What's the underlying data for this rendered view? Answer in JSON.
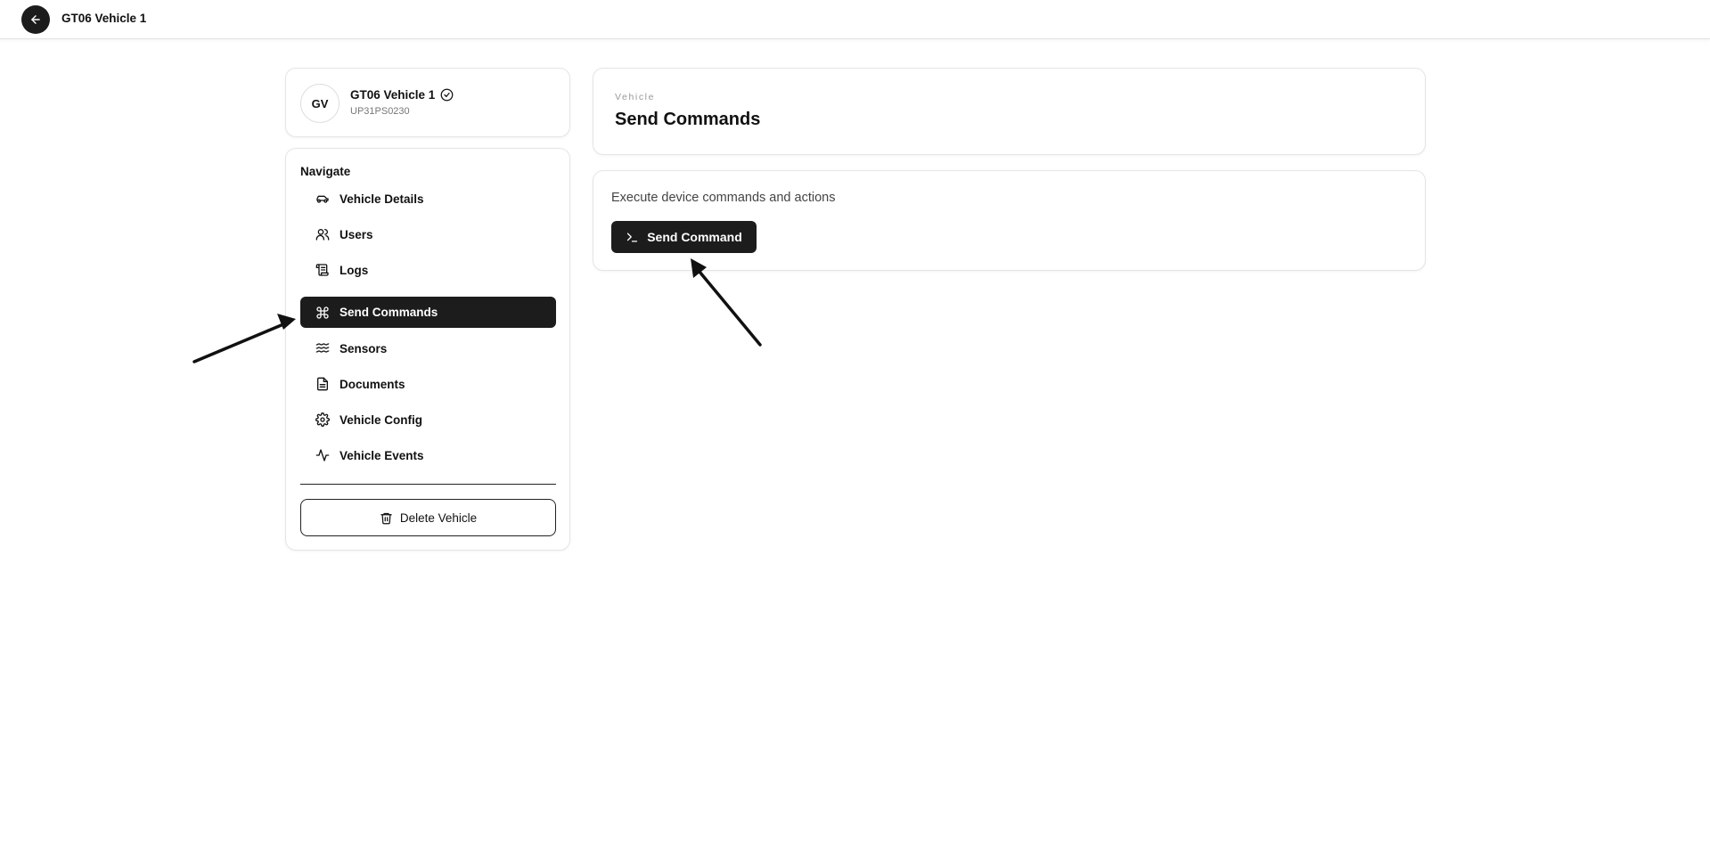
{
  "topbar": {
    "title": "GT06 Vehicle 1",
    "back_icon": "arrow-left-icon"
  },
  "vehicle": {
    "initials": "GV",
    "name": "GT06 Vehicle 1",
    "plate": "UP31PS0230",
    "verified_icon": "check-circle-icon"
  },
  "nav": {
    "heading": "Navigate",
    "items": [
      {
        "label": "Vehicle Details",
        "icon": "car-icon",
        "active": false
      },
      {
        "label": "Users",
        "icon": "users-icon",
        "active": false
      },
      {
        "label": "Logs",
        "icon": "scroll-icon",
        "active": false
      },
      {
        "label": "Send Commands",
        "icon": "command-icon",
        "active": true
      },
      {
        "label": "Sensors",
        "icon": "waves-icon",
        "active": false
      },
      {
        "label": "Documents",
        "icon": "file-text-icon",
        "active": false
      },
      {
        "label": "Vehicle Config",
        "icon": "gear-icon",
        "active": false
      },
      {
        "label": "Vehicle Events",
        "icon": "activity-icon",
        "active": false
      }
    ],
    "delete_label": "Delete Vehicle",
    "delete_icon": "trash-icon"
  },
  "header": {
    "eyebrow": "Vehicle",
    "title": "Send Commands"
  },
  "content": {
    "description": "Execute device commands and actions",
    "button_label": "Send Command",
    "button_icon": "terminal-icon"
  },
  "colors": {
    "dark": "#1c1c1c",
    "border": "#e5e5e5",
    "muted": "#777777"
  }
}
